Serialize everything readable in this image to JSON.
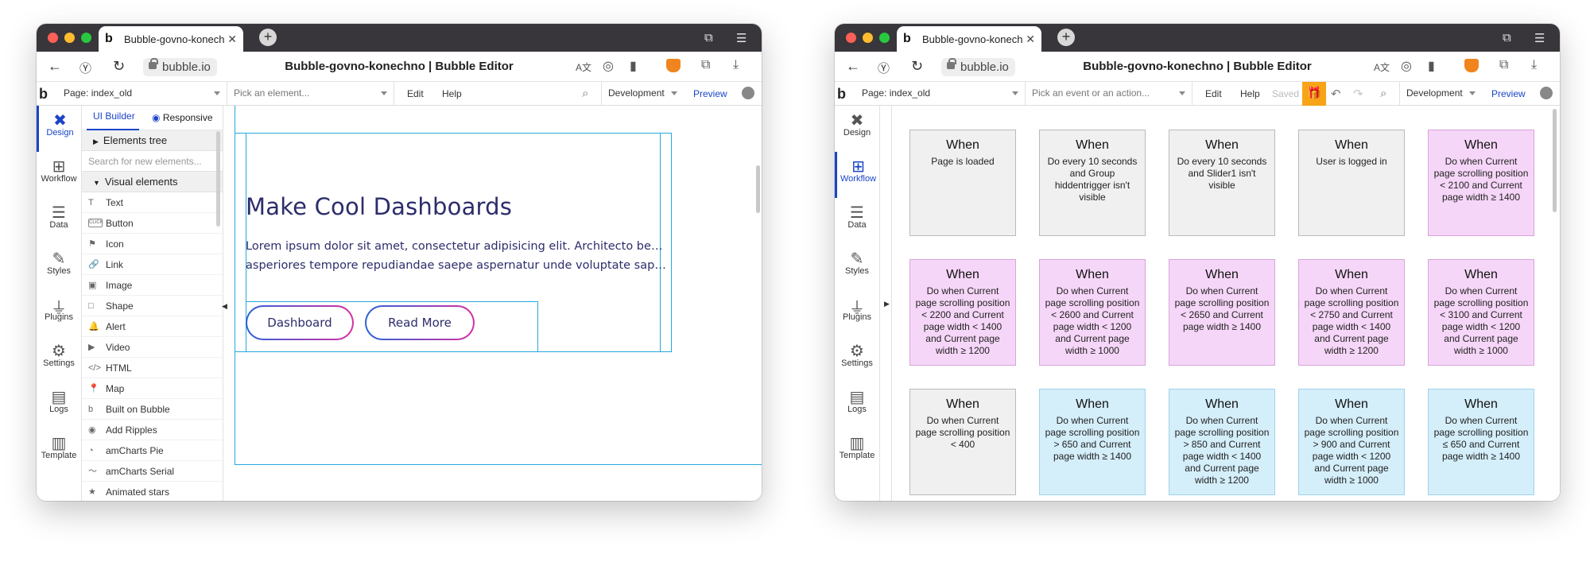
{
  "browser": {
    "tab_title": "Bubble-govno-konechno",
    "new_tab": "+",
    "url": "bubble.io",
    "page_title": "Bubble-govno-konechno | Bubble Editor"
  },
  "editor_left": {
    "page_selector": "Page: index_old",
    "picker_placeholder": "Pick an element...",
    "menu_edit": "Edit",
    "menu_help": "Help",
    "env": "Development",
    "preview": "Preview"
  },
  "editor_right": {
    "page_selector": "Page: index_old",
    "picker_placeholder": "Pick an event or an action...",
    "menu_edit": "Edit",
    "menu_help": "Help",
    "saved": "Saved",
    "env": "Development",
    "preview": "Preview"
  },
  "nav": [
    "Design",
    "Workflow",
    "Data",
    "Styles",
    "Plugins",
    "Settings",
    "Logs",
    "Template"
  ],
  "elements_panel": {
    "tab_ui_builder": "UI Builder",
    "tab_responsive": "Responsive",
    "elements_tree": "Elements tree",
    "search_placeholder": "Search for new elements...",
    "visual_elements": "Visual elements",
    "items": [
      {
        "label": "Text",
        "icon": "T"
      },
      {
        "label": "Button",
        "icon": "CLICK"
      },
      {
        "label": "Icon",
        "icon": "⚑"
      },
      {
        "label": "Link",
        "icon": "🔗"
      },
      {
        "label": "Image",
        "icon": "▣"
      },
      {
        "label": "Shape",
        "icon": "□"
      },
      {
        "label": "Alert",
        "icon": "🔔"
      },
      {
        "label": "Video",
        "icon": "▶"
      },
      {
        "label": "HTML",
        "icon": "</>"
      },
      {
        "label": "Map",
        "icon": "📍"
      },
      {
        "label": "Built on Bubble",
        "icon": "b"
      },
      {
        "label": "Add Ripples",
        "icon": "◉"
      },
      {
        "label": "amCharts Pie",
        "icon": "◔"
      },
      {
        "label": "amCharts Serial",
        "icon": "〜"
      },
      {
        "label": "Animated stars",
        "icon": "★"
      }
    ]
  },
  "hero": {
    "title": "Make Cool Dashboards",
    "line1": "Lorem ipsum dolor sit amet, consectetur adipisicing elit. Architecto beatae,",
    "line2": "asperiores tempore repudiandae saepe aspernatur unde voluptate sapient...",
    "btn_dashboard": "Dashboard",
    "btn_read_more": "Read More"
  },
  "workflow": {
    "when_label": "When",
    "cards": [
      {
        "text": "Page is loaded",
        "color": "gray"
      },
      {
        "text": "Do every 10 seconds and Group hiddentrigger isn't visible",
        "color": "gray"
      },
      {
        "text": "Do every 10 seconds and Slider1 isn't visible",
        "color": "gray"
      },
      {
        "text": "User is logged in",
        "color": "gray"
      },
      {
        "text": "Do when Current page scrolling position < 2100 and Current page width ≥ 1400",
        "color": "pink"
      },
      {
        "text": "Do when Current page scrolling position < 2200 and Current page width < 1400 and Current page width ≥ 1200",
        "color": "pink"
      },
      {
        "text": "Do when Current page scrolling position < 2600 and Current page width < 1200 and Current page width ≥ 1000",
        "color": "pink"
      },
      {
        "text": "Do when Current page scrolling position < 2650 and Current page width ≥ 1400",
        "color": "pink"
      },
      {
        "text": "Do when Current page scrolling position < 2750 and Current page width < 1400 and Current page width ≥ 1200",
        "color": "pink"
      },
      {
        "text": "Do when Current page scrolling position < 3100 and Current page width < 1200 and Current page width ≥ 1000",
        "color": "pink"
      },
      {
        "text": "Do when Current page scrolling position < 400",
        "color": "gray"
      },
      {
        "text": "Do when Current page scrolling position > 650 and Current page width ≥ 1400",
        "color": "blue"
      },
      {
        "text": "Do when Current page scrolling position > 850 and Current page width < 1400 and Current page width ≥ 1200",
        "color": "blue"
      },
      {
        "text": "Do when Current page scrolling position > 900 and Current page width < 1200 and Current page width ≥ 1000",
        "color": "blue"
      },
      {
        "text": "Do when Current page scrolling position ≤ 650 and Current page width ≥ 1400",
        "color": "blue"
      }
    ]
  },
  "colors": {
    "accent": "#1a44c8",
    "card_gray": "#f0f0f0",
    "card_pink": "#f6d6f8",
    "card_blue": "#d4eefa",
    "guide_line": "#26a8dc",
    "gift_button": "#f7a416",
    "hero_text": "#2c2d6b"
  }
}
